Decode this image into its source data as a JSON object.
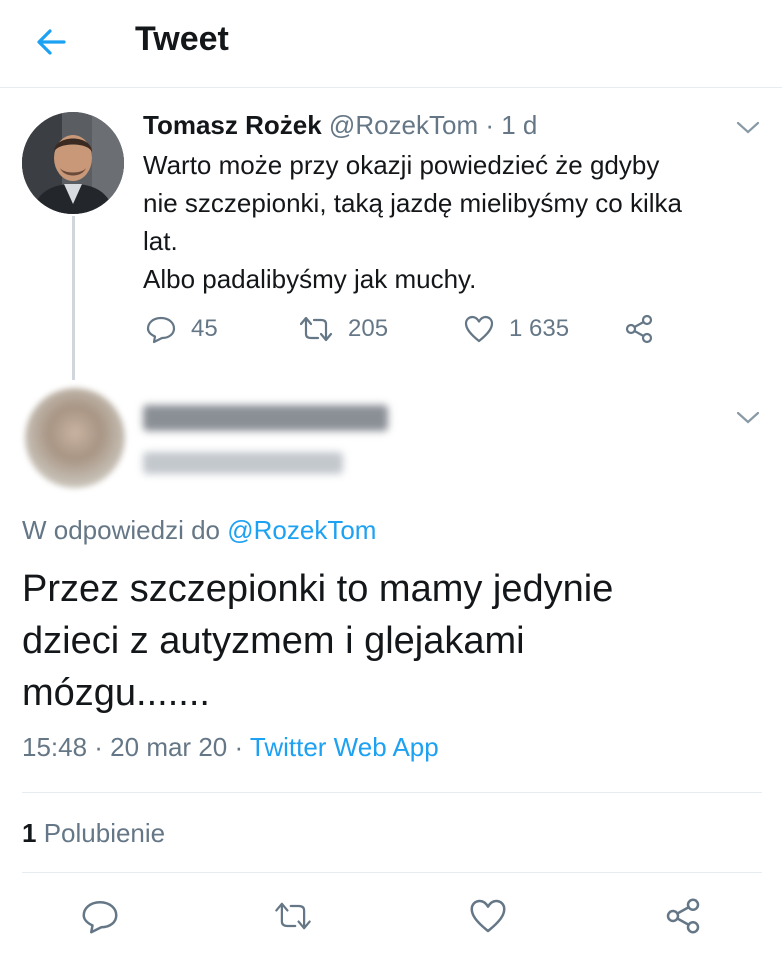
{
  "header": {
    "title": "Tweet",
    "back_icon": "arrow-left-icon",
    "accent": "#1da1f2"
  },
  "parent_tweet": {
    "author_name": "Tomasz Rożek",
    "author_handle": "@RozekTom",
    "time_sep": " · ",
    "time": "1 d",
    "text_lines": [
      "Warto może przy okazji powiedzieć że gdyby",
      "nie szczepionki, taką jazdę mielibyśmy co kilka",
      "lat.",
      "Albo padalibyśmy jak muchy."
    ],
    "reply_count": "45",
    "retweet_count": "205",
    "like_count": "1 635"
  },
  "reply_tweet": {
    "replying_prefix": "W odpowiedzi do ",
    "replying_to": "@RozekTom",
    "text_lines": [
      "Przez szczepionki to mamy jedynie",
      "dzieci z autyzmem i glejakami",
      "mózgu......."
    ],
    "timestamp": "15:48 · 20 mar 20 · ",
    "source": "Twitter Web App",
    "like_count": "1",
    "like_label": " Polubienie"
  },
  "colors": {
    "text": "#14171a",
    "muted": "#657786",
    "link": "#1da1f2",
    "border": "#e6ecf0"
  }
}
